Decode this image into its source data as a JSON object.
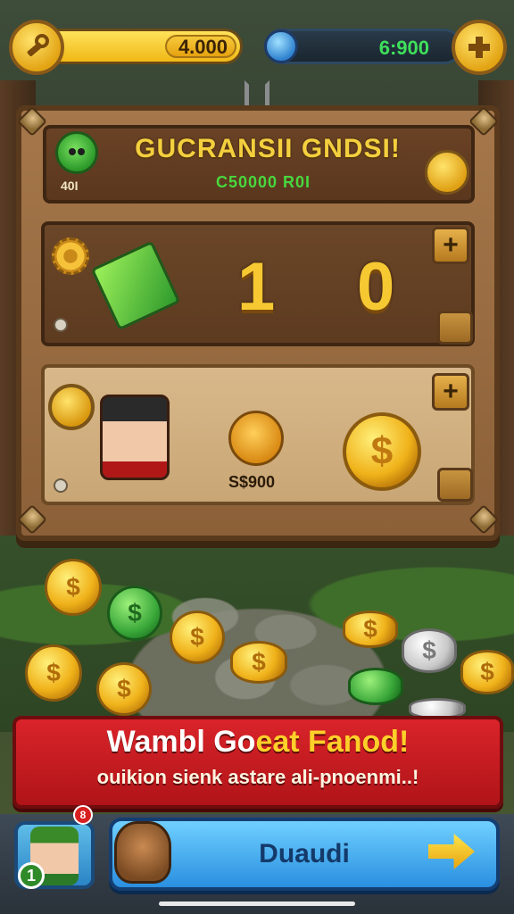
{
  "top_bar": {
    "gold_amount": "4.000",
    "gem_amount": "6:900"
  },
  "board": {
    "header": {
      "title": "GUCRANSII GNDSI!",
      "subtitle": "C50000 R0I",
      "count": "40I"
    },
    "stats": {
      "value_1": "1",
      "value_2": "0"
    },
    "reward": {
      "boar_price": "S$900",
      "coin_symbol": "$"
    }
  },
  "coins": {
    "symbol": "$"
  },
  "banner": {
    "title_part1": "Wambl Go",
    "title_highlight": "eat",
    "title_part2": " Fanod!",
    "subtitle": "ouikion sienk astare ali-pnoenmi..!"
  },
  "bottom": {
    "player_level": "1",
    "notification_count": "8",
    "action_label": "Duaudi"
  },
  "colors": {
    "accent_gold": "#f6c832",
    "banner_red": "#d9242a",
    "action_blue": "#2a8fe0",
    "gem_green": "#3ee05a"
  },
  "icons": [
    "key-icon",
    "gem-icon",
    "plus-icon",
    "goblin-icon",
    "gear-icon",
    "coin-icon",
    "boar-icon",
    "bear-icon",
    "arrow-icon"
  ]
}
